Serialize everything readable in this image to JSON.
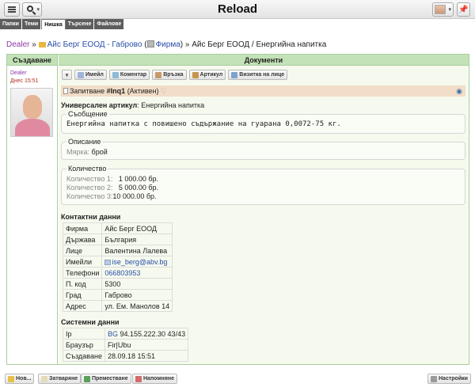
{
  "app": {
    "title": "Reload"
  },
  "tabs": [
    "Папки",
    "Теми",
    "Нишка",
    "Търсене",
    "Файлове"
  ],
  "active_tab": "Нишка",
  "breadcrumb": {
    "dealer": "Dealer",
    "sep1": "»",
    "company_link": "Айс Берг ЕООД - Габрово",
    "paren_open": "(",
    "firm_link": "Фирма",
    "paren_close": ")",
    "sep2": "»",
    "current": "Айс Берг ЕООД / Енергийна напитка"
  },
  "columns": {
    "left": "Създаване",
    "right": "Документи"
  },
  "author": {
    "name": "Dealer",
    "date": "Днес 15:51"
  },
  "toolbar": {
    "email": "Имейл",
    "comment": "Коментар",
    "link": "Връзка",
    "article": "Артикул",
    "card": "Визитка на лице"
  },
  "document": {
    "prefix": "Запитване",
    "id": "#Inq1",
    "status": "(Активен)",
    "universal_label": "Универсален артикул",
    "universal_value": ": Енергийна напитка",
    "message_legend": "Съобщение",
    "message": "Енергийна напитка с повишено съдържание на гуарана 0,0072-75 кг.",
    "description_legend": "Описание",
    "measure_label": "Мярка:",
    "measure_value": "брой",
    "quantity_legend": "Количество",
    "quantities": [
      {
        "label": "Количество 1:",
        "value": "  1 000.00 бр."
      },
      {
        "label": "Количество 2:",
        "value": "  5 000.00 бр."
      },
      {
        "label": "Количество 3:",
        "value": "10 000.00 бр."
      }
    ]
  },
  "contacts": {
    "title": "Контактни данни",
    "rows": [
      {
        "label": "Фирма",
        "value": "Айс Берг ЕООД"
      },
      {
        "label": "Държава",
        "value": "България"
      },
      {
        "label": "Лице",
        "value": "Валентина Лалева"
      },
      {
        "label": "Имейли",
        "value": "ise_berg@abv.bg"
      },
      {
        "label": "Телефони",
        "value": "066803953"
      },
      {
        "label": "П. код",
        "value": "5300"
      },
      {
        "label": "Град",
        "value": "Габрово"
      },
      {
        "label": "Адрес",
        "value": "ул. Ем. Манолов 14"
      }
    ]
  },
  "system": {
    "title": "Системни данни",
    "rows": [
      {
        "label": "Ip",
        "prefix": "BG",
        "value": " 94.155.222.30 43/43"
      },
      {
        "label": "Браузър",
        "prefix": "",
        "value": "Fir|Ubu"
      },
      {
        "label": "Създаване",
        "prefix": "",
        "value": "28.09.18 15:51"
      }
    ]
  },
  "bottom": {
    "new": "Нов...",
    "close": "Затваряне",
    "move": "Преместване",
    "remind": "Напомняне",
    "settings": "Настройки"
  },
  "colors": {
    "header_green": "#c3e2b7",
    "doc_bar": "#f1ddc8",
    "link": "#2a4fa8",
    "dealer": "#8d36a8"
  }
}
